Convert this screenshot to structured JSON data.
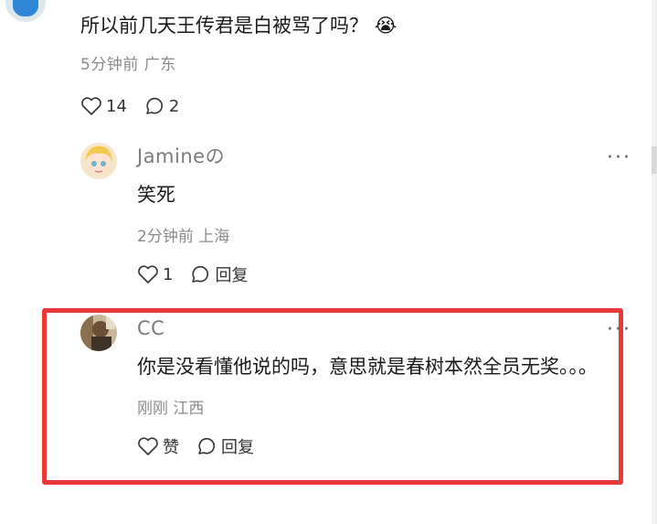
{
  "main_comment": {
    "text": "所以前几天王传君是白被骂了吗？",
    "emoji": "😭",
    "time": "5分钟前",
    "location": "广东",
    "likes": "14",
    "replies": "2"
  },
  "replies": [
    {
      "name": "Jamineの",
      "text": "笑死",
      "time": "2分钟前",
      "location": "上海",
      "likes": "1",
      "reply_label": "回复",
      "more_label": "···"
    },
    {
      "name": "CC",
      "text": "你是没看懂他说的吗，意思就是春树本然全员无奖。。。",
      "time": "刚刚",
      "location": "江西",
      "like_label": "赞",
      "reply_label": "回复",
      "more_label": "···"
    }
  ],
  "colors": {
    "highlight": "#e8383a",
    "meta_text": "#8a8a8a",
    "name_text": "#7a7a7a"
  }
}
